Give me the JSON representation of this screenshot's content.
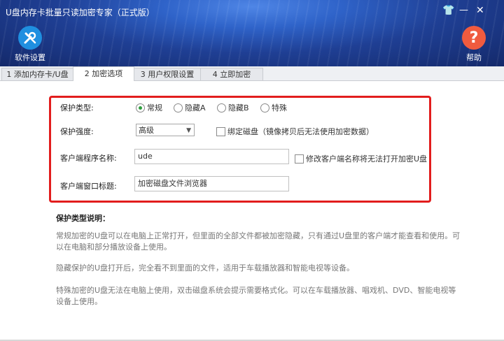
{
  "window": {
    "title": "U盘内存卡批量只读加密专家（正式版）",
    "controls": {
      "skin": "👕",
      "minimize": "—",
      "close": "✕"
    }
  },
  "toolbar": {
    "settings_label": "软件设置",
    "help_label": "帮助",
    "help_glyph": "?",
    "settings_icon": "wrench-screwdriver-icon",
    "help_icon": "question-icon"
  },
  "tabs": [
    "1 添加内存卡/U盘",
    "2 加密选项",
    "3 用户权限设置",
    "4 立即加密"
  ],
  "active_tab": 1,
  "form": {
    "protect_type_label": "保护类型:",
    "protect_types": [
      "常规",
      "隐藏A",
      "隐藏B",
      "特殊"
    ],
    "protect_type_selected": "常规",
    "protect_strength_label": "保护强度:",
    "protect_strength_value": "高级",
    "bind_disk_label": "绑定磁盘（镜像拷贝后无法使用加密数据）",
    "client_name_label": "客户端程序名称:",
    "client_name_value": "ude",
    "rename_warning_label": "修改客户端名称将无法打开加密U盘",
    "window_title_label": "客户端窗口标题:",
    "window_title_value": "加密磁盘文件浏览器"
  },
  "description": {
    "title": "保护类型说明：",
    "paragraphs": [
      "常规加密的U盘可以在电脑上正常打开，但里面的全部文件都被加密隐藏，只有通过U盘里的客户端才能查看和使用。可以在电脑和部分播放设备上使用。",
      "隐藏保护的U盘打开后，完全看不到里面的文件，适用于车载播放器和智能电视等设备。",
      "特殊加密的U盘无法在电脑上使用，双击磁盘系统会提示需要格式化。可以在车载播放器、唱戏机、DVD、智能电视等设备上使用。"
    ]
  },
  "colors": {
    "highlight_border": "#e21d1d",
    "settings_circle": "#1f8fe0",
    "help_circle": "#f05b3f",
    "radio_selected": "#2e9e3e"
  }
}
